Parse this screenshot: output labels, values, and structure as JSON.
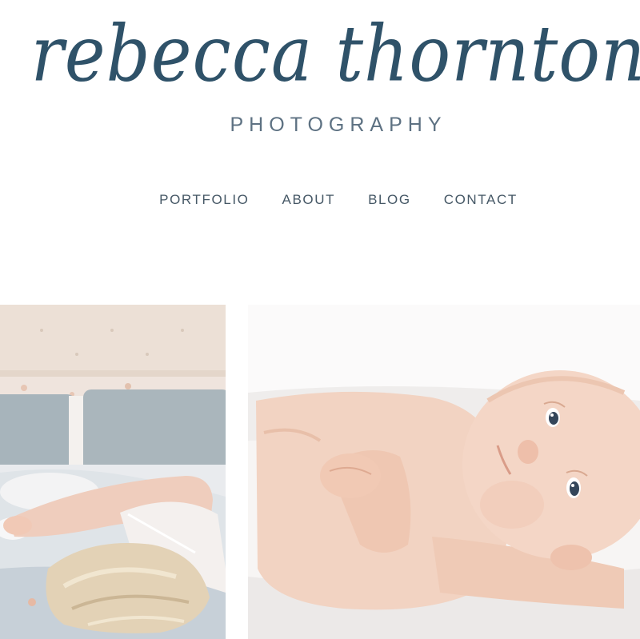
{
  "site": {
    "logo_script": "rebecca thornton",
    "logo_sub": "PHOTOGRAPHY"
  },
  "nav": {
    "items": [
      {
        "label": "PORTFOLIO"
      },
      {
        "label": "ABOUT"
      },
      {
        "label": "BLOG"
      },
      {
        "label": "CONTACT"
      }
    ]
  },
  "gallery": {
    "images": [
      {
        "subject": "mother-lying-on-bed"
      },
      {
        "subject": "newborn-baby"
      }
    ]
  },
  "colors": {
    "brand": "#2f5269",
    "nav_text": "#465866",
    "subtitle": "#5d7182",
    "background": "#ffffff"
  }
}
